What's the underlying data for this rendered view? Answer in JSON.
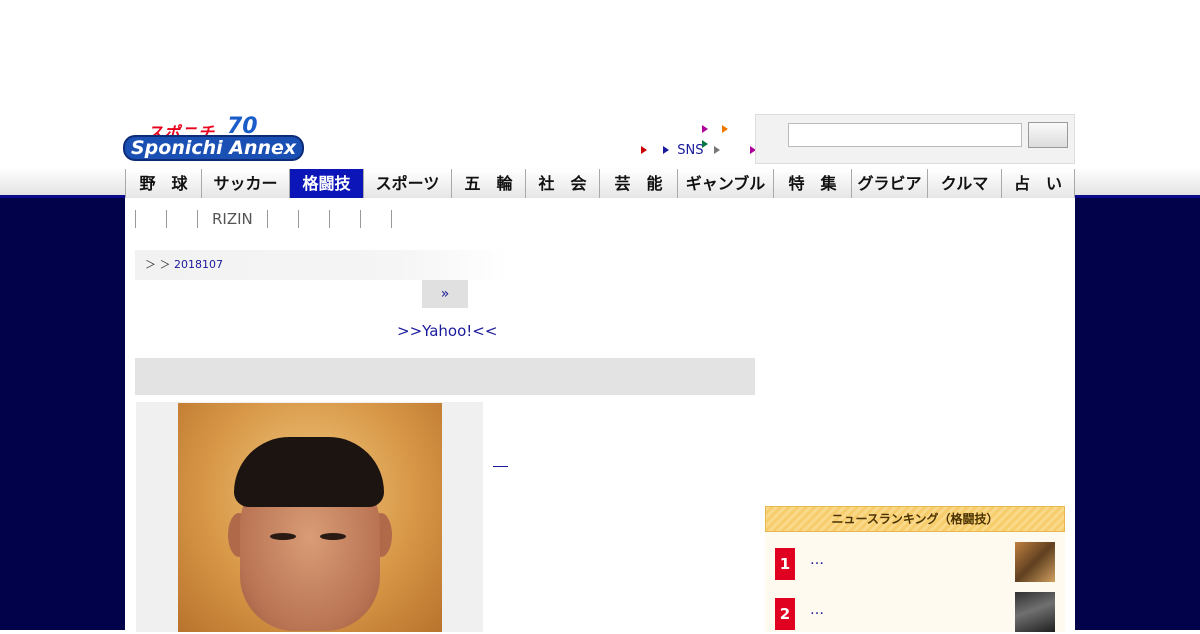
{
  "logo": {
    "top_text": "スポニチ",
    "anniversary": "70",
    "bottom_text": "Sponichi Annex"
  },
  "header_links": {
    "sns": "SNS"
  },
  "search": {
    "value": "",
    "button_label": ""
  },
  "nav": {
    "items": [
      {
        "label": "野　球"
      },
      {
        "label": "サッカー"
      },
      {
        "label": "格闘技",
        "active": true
      },
      {
        "label": "スポーツ"
      },
      {
        "label": "五　輪"
      },
      {
        "label": "社　会"
      },
      {
        "label": "芸　能"
      },
      {
        "label": "ギャンブル"
      },
      {
        "label": "特　集"
      },
      {
        "label": "グラビア"
      },
      {
        "label": "クルマ"
      },
      {
        "label": "占　い"
      }
    ],
    "active_color": "#0c16b8"
  },
  "subnav": {
    "items": [
      "RIZIN"
    ]
  },
  "breadcrumb": {
    "prefix": "＞ ＞",
    "date": "2018107"
  },
  "pager": {
    "next": "»"
  },
  "yahoo_link": ">>Yahoo!<<",
  "ranking": {
    "title": "ニュースランキング（格闘技）",
    "items": [
      {
        "rank": "1",
        "text": "…",
        "thumb": "boxing-ring-photo"
      },
      {
        "rank": "2",
        "text": "…",
        "thumb": "ring-photo"
      }
    ]
  },
  "colors": {
    "navy_background": "#02024a",
    "link": "#1a1a9c",
    "rank_red": "#e00020"
  }
}
